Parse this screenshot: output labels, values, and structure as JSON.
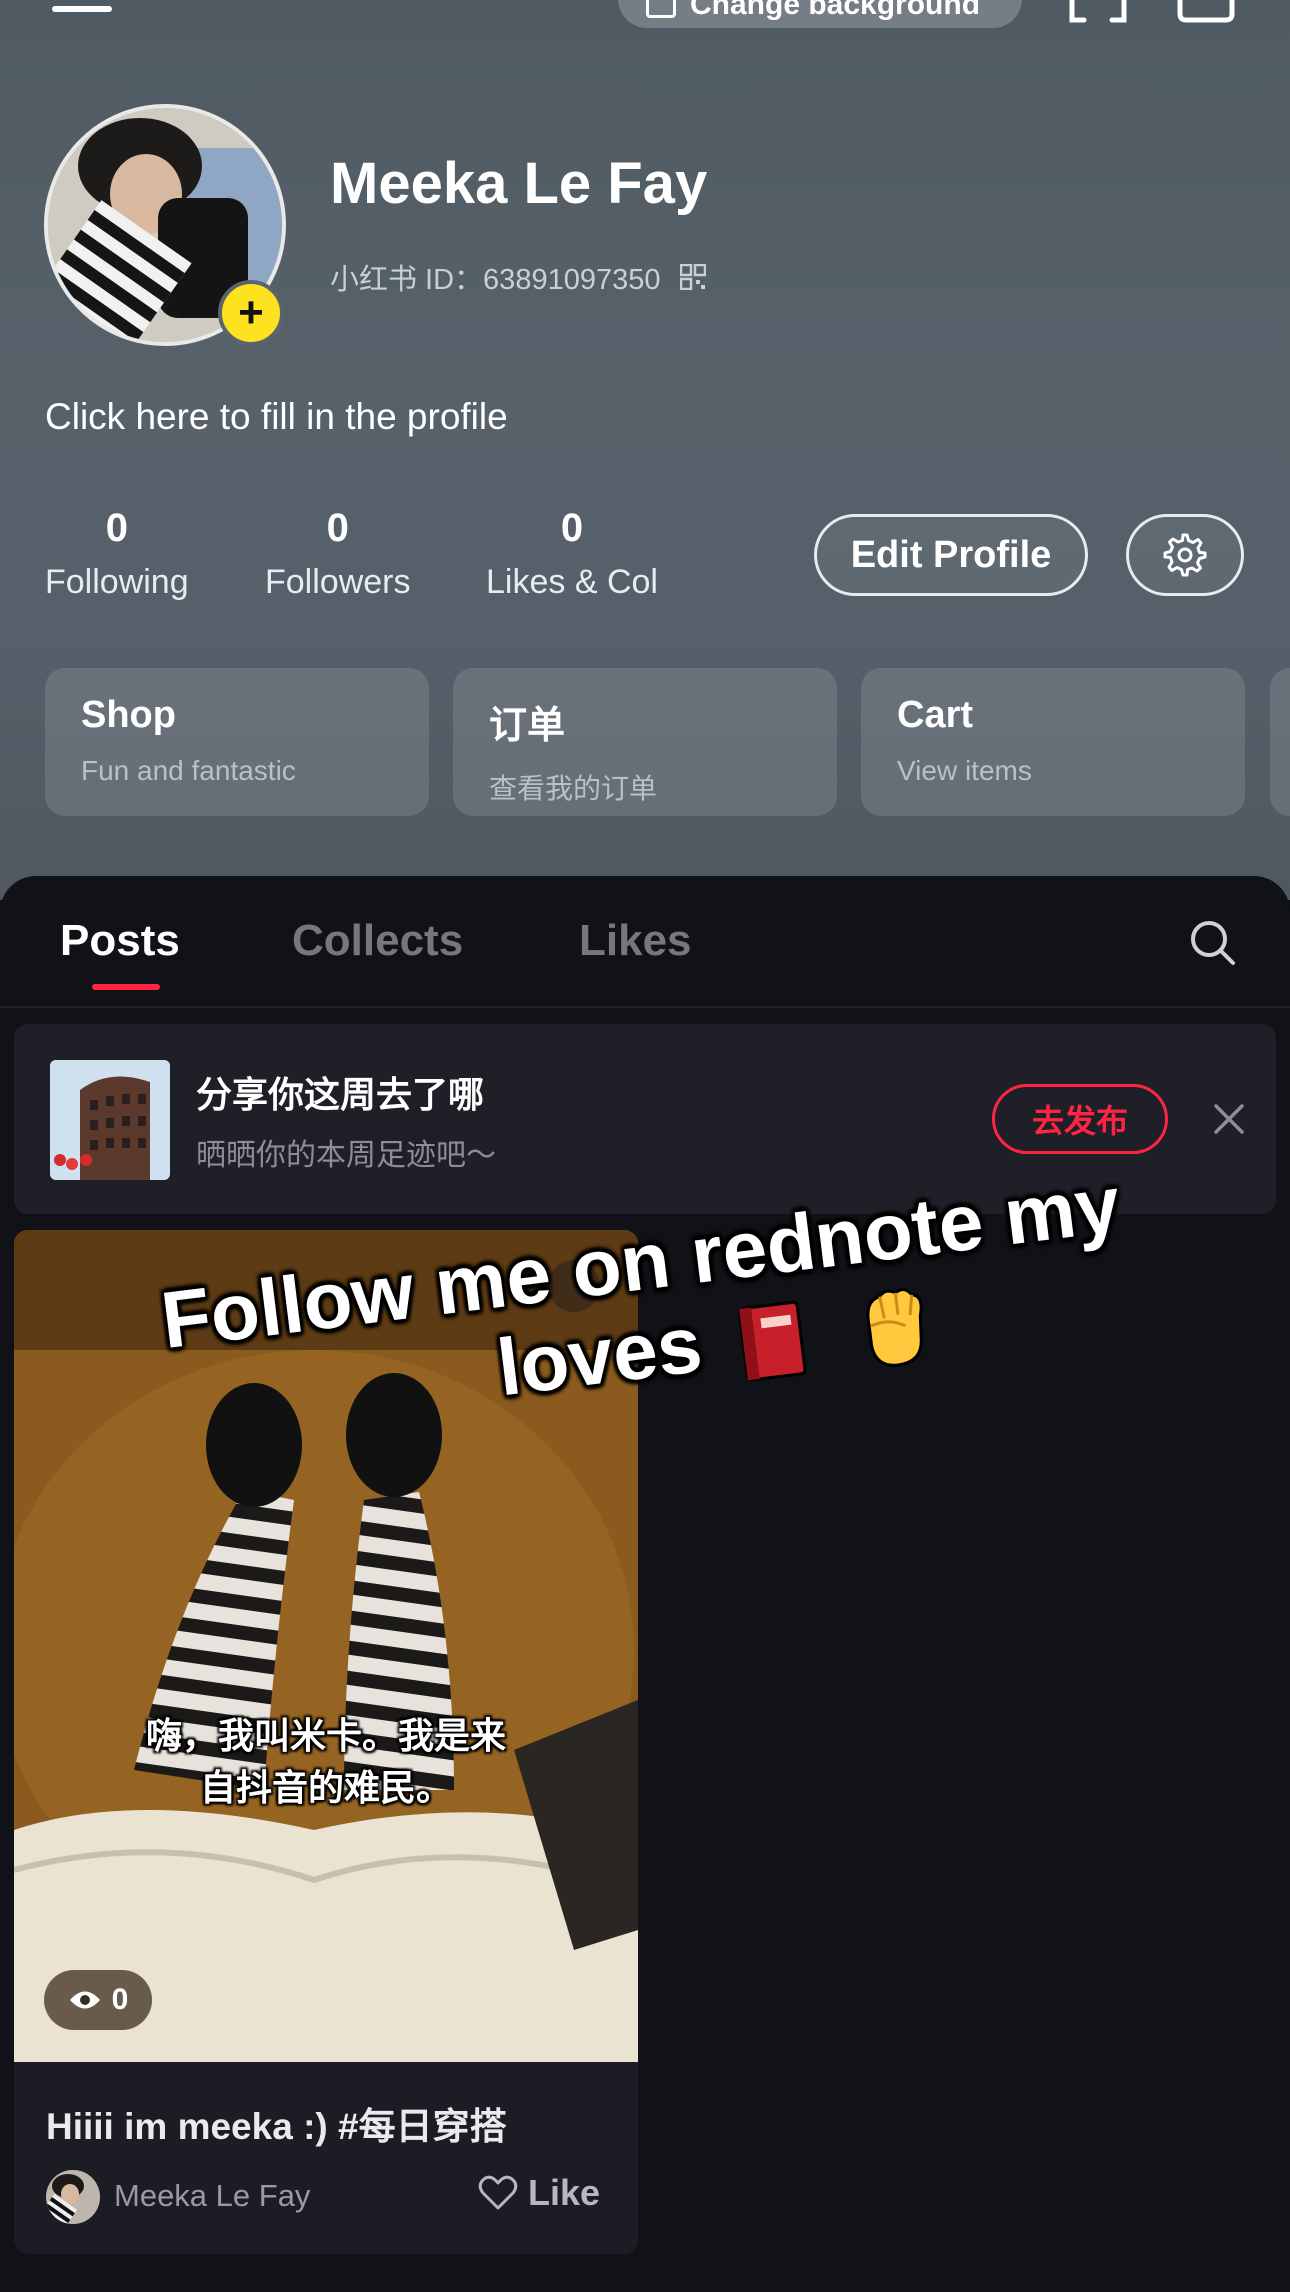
{
  "header": {
    "change_background_label": "Change background",
    "icons": [
      "menu-icon",
      "image-icon",
      "scan-icon",
      "share-icon"
    ]
  },
  "profile": {
    "name": "Meeka Le Fay",
    "id_text": "小红书 ID：63891097350",
    "bio_placeholder": "Click here to fill in the profile",
    "add_icon": "+",
    "stats": [
      {
        "value": "0",
        "label": "Following"
      },
      {
        "value": "0",
        "label": "Followers"
      },
      {
        "value": "0",
        "label": "Likes & Col"
      }
    ],
    "edit_label": "Edit Profile"
  },
  "shortcuts": [
    {
      "title": "Shop",
      "subtitle": "Fun and fantastic"
    },
    {
      "title": "订单",
      "subtitle": "查看我的订单"
    },
    {
      "title": "Cart",
      "subtitle": "View items"
    }
  ],
  "tabs": [
    {
      "label": "Posts",
      "active": true
    },
    {
      "label": "Collects",
      "active": false
    },
    {
      "label": "Likes",
      "active": false
    }
  ],
  "prompt": {
    "title": "分享你这周去了哪",
    "subtitle": "晒晒你的本周足迹吧～",
    "button_label": "去发布"
  },
  "post": {
    "caption_lines": [
      "嗨，我叫米卡。我是来",
      "自抖音的难民。"
    ],
    "views": "0",
    "title": "Hiiii im meeka :) #每日穿搭",
    "author": "Meeka Le Fay",
    "like_label": "Like"
  },
  "overlay": {
    "line1": "Follow me on rednote my",
    "line2": "loves"
  },
  "colors": {
    "accent": "#ff2442",
    "avatar_badge": "#ffe21f",
    "header_bg": "#56606a",
    "panel_bg": "#111118"
  }
}
